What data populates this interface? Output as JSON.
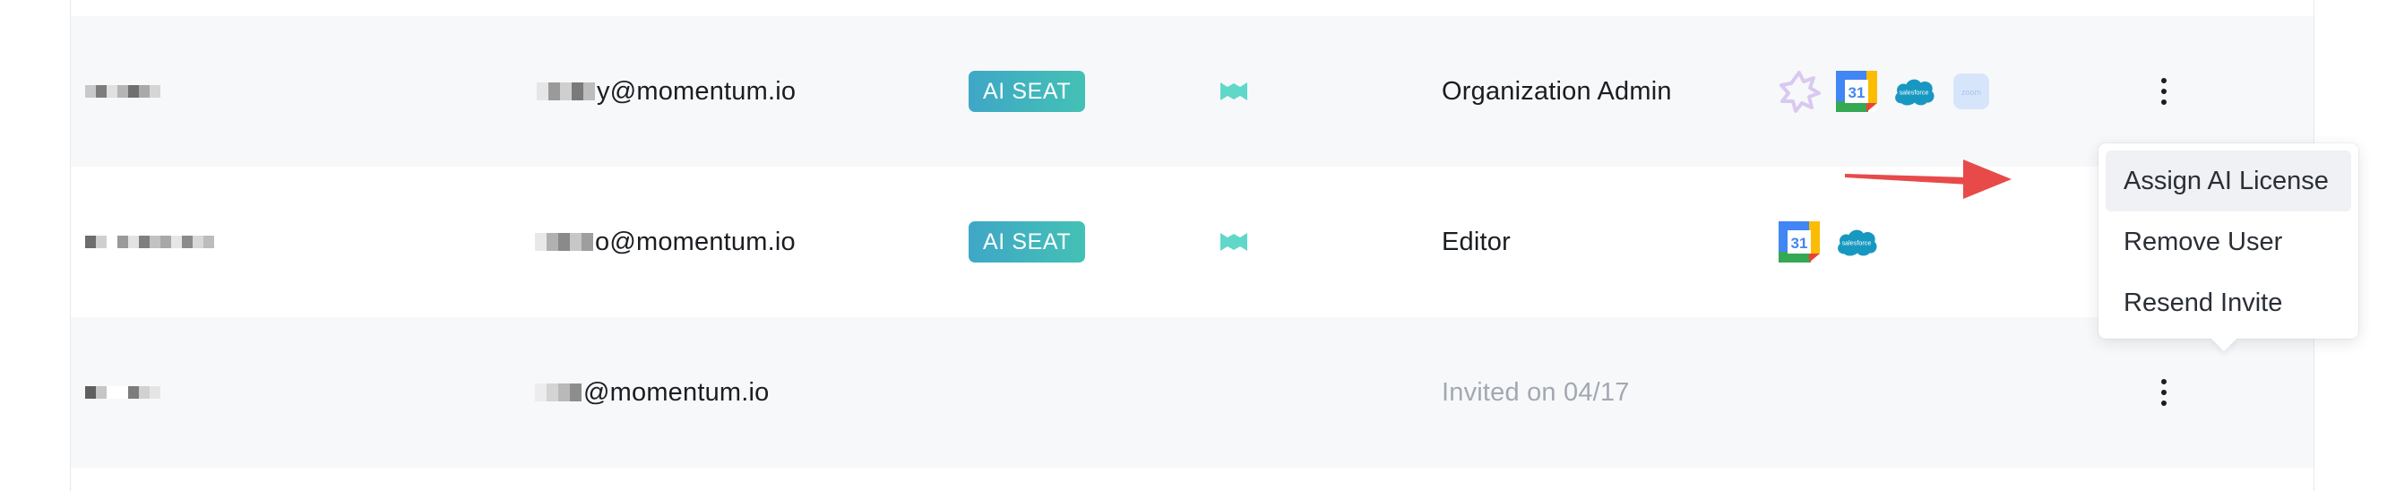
{
  "colors": {
    "seat_gradient_start": "#3fa7c7",
    "seat_gradient_end": "#43c1b4",
    "momentum_logo": "#5fd8c9",
    "arrow": "#e84a4a",
    "muted_text": "#a3a8b1"
  },
  "rows": [
    {
      "email_suffix": "y@momentum.io",
      "badge": "AI SEAT",
      "product_icon": "momentum-logo-icon",
      "role": "Organization Admin",
      "integrations": [
        "gong-icon",
        "google-calendar-icon",
        "salesforce-icon",
        "zoom-icon"
      ],
      "actions_icon": "kebab-menu-icon"
    },
    {
      "email_suffix": "o@momentum.io",
      "badge": "AI SEAT",
      "product_icon": "momentum-logo-icon",
      "role": "Editor",
      "integrations": [
        "google-calendar-icon",
        "salesforce-icon"
      ],
      "actions_icon": "kebab-menu-icon"
    },
    {
      "email_suffix": "@momentum.io",
      "badge": "",
      "product_icon": "",
      "role": "Invited on 04/17",
      "integrations": [],
      "actions_icon": "kebab-menu-icon"
    }
  ],
  "calendar_day": "31",
  "salesforce_label": "salesforce",
  "zoom_label": "zoom",
  "menu": {
    "items": [
      "Assign AI License",
      "Remove User",
      "Resend Invite"
    ],
    "highlighted": "Assign AI License"
  }
}
